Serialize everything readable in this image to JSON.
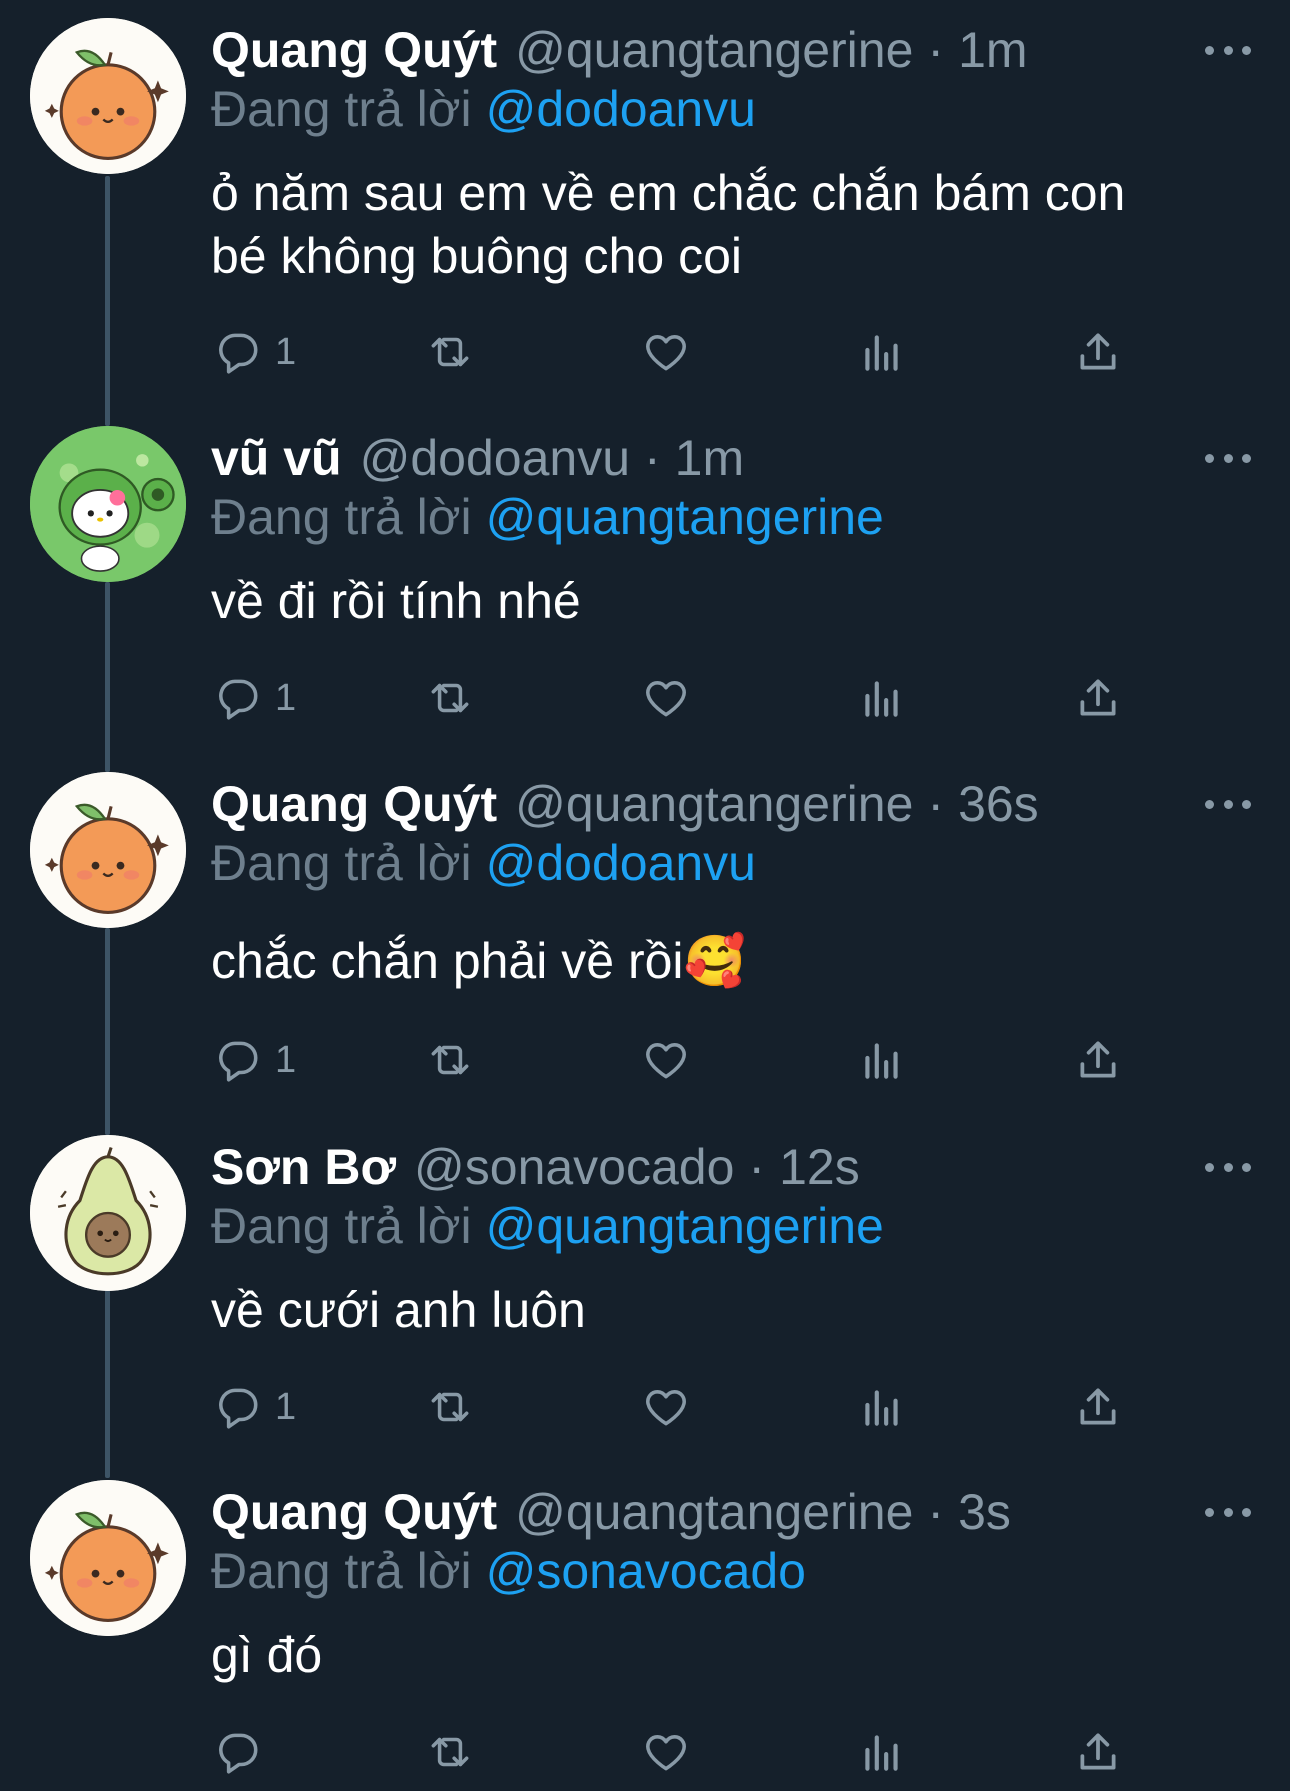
{
  "reply_prefix": "Đang trả lời",
  "tweets": [
    {
      "name": "Quang Quýt",
      "handle": "@quangtangerine",
      "separator": "·",
      "time": "1m",
      "reply_to": "@dodoanvu",
      "text_lines": [
        "ỏ năm sau em về em chắc chắn bám con",
        "bé không buông cho coi"
      ],
      "reply_count": "1",
      "avatar": "orange"
    },
    {
      "name": "vũ vũ",
      "handle": "@dodoanvu",
      "separator": "·",
      "time": "1m",
      "reply_to": "@quangtangerine",
      "text_lines": [
        "về đi rồi tính nhé"
      ],
      "reply_count": "1",
      "avatar": "green-kitty"
    },
    {
      "name": "Quang Quýt",
      "handle": "@quangtangerine",
      "separator": "·",
      "time": "36s",
      "reply_to": "@dodoanvu",
      "text_lines": [
        "chắc chắn phải về rồi🥰"
      ],
      "reply_count": "1",
      "avatar": "orange"
    },
    {
      "name": "Sơn Bơ",
      "handle": "@sonavocado",
      "separator": "·",
      "time": "12s",
      "reply_to": "@quangtangerine",
      "text_lines": [
        "về cưới anh luôn"
      ],
      "reply_count": "1",
      "avatar": "avocado"
    },
    {
      "name": "Quang Quýt",
      "handle": "@quangtangerine",
      "separator": "·",
      "time": "3s",
      "reply_to": "@sonavocado",
      "text_lines": [
        "gì đó"
      ],
      "reply_count": "",
      "avatar": "orange"
    }
  ],
  "icons": {
    "reply": "reply-icon",
    "retweet": "retweet-icon",
    "like": "heart-icon",
    "analytics": "analytics-icon",
    "share": "share-icon",
    "more": "more-icon"
  },
  "colors": {
    "background": "#15202b",
    "secondary_text": "#8899a6",
    "mention": "#1da1f2",
    "thread_line": "#3d5466"
  }
}
